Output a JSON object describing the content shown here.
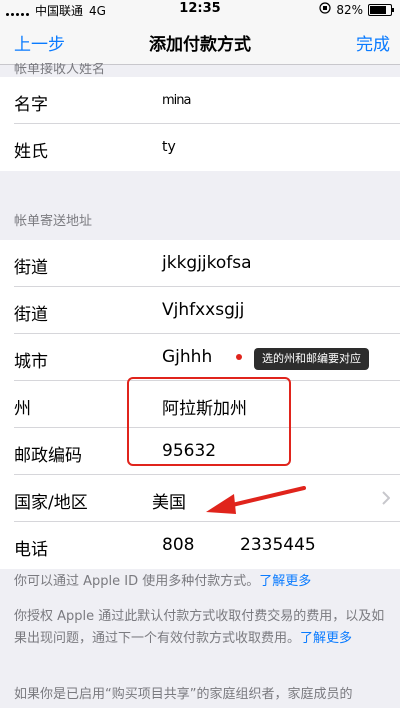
{
  "status": {
    "carrier": "中国联通",
    "network": "4G",
    "time": "12:35",
    "battery": "82%",
    "battery_level": 0.82
  },
  "nav": {
    "back": "上一步",
    "title": "添加付款方式",
    "done": "完成"
  },
  "billing_name": {
    "header_partial": "帐单接收人姓名",
    "rows": [
      {
        "label": "名字",
        "value": "mina"
      },
      {
        "label": "姓氏",
        "value": "ty"
      }
    ]
  },
  "address": {
    "header": "帐单寄送地址",
    "street1_label": "街道",
    "street1_value": "jkkgjjkofsa",
    "street2_label": "街道",
    "street2_value": "Vjhfxxsgjj",
    "city_label": "城市",
    "city_value": "Gjhhh",
    "state_label": "州",
    "state_value": "阿拉斯加州",
    "zip_label": "邮政编码",
    "zip_value": "95632",
    "country_label": "国家/地区",
    "country_value": "美国",
    "phone_label": "电话",
    "phone_area": "808",
    "phone_number": "2335445"
  },
  "annotation": {
    "tooltip": "选的州和邮编要对应",
    "box_color": "#e0241c"
  },
  "footer": {
    "p1": "你可以通过 Apple ID 使用多种付款方式。",
    "p1_link": "了解更多",
    "p2": "你授权 Apple 通过此默认付款方式收取付费交易的费用，以及如果出现问题，通过下一个有效付款方式收取费用。",
    "p2_link": "了解更多",
    "p3": "如果你是已启用“购买项目共享”的家庭组织者，家庭成员的"
  },
  "colors": {
    "accent": "#0a7bff",
    "background": "#efeff4",
    "annotation": "#e0241c"
  }
}
